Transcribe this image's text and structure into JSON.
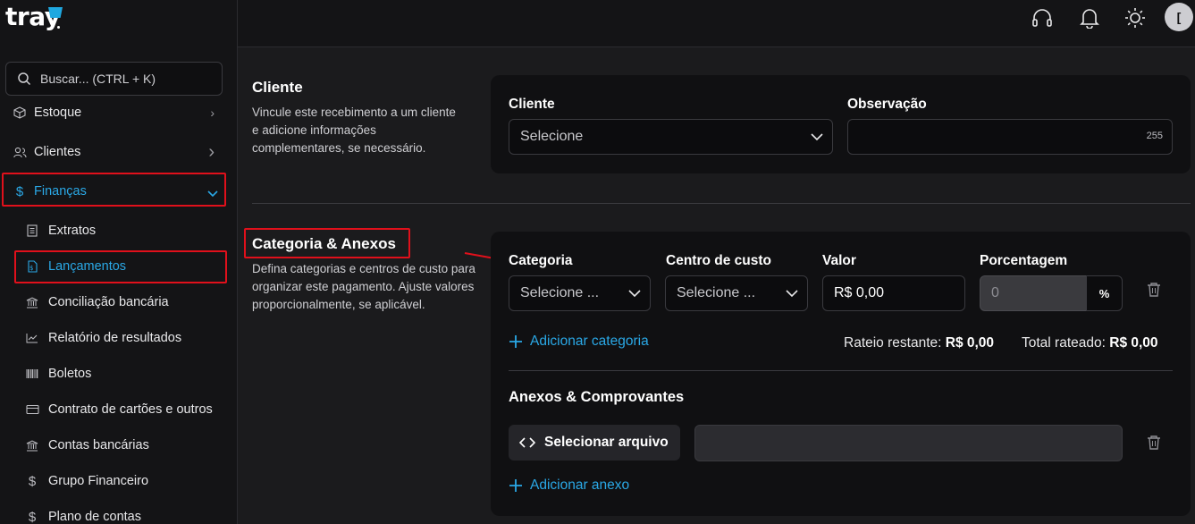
{
  "brand": {
    "logo_text": "tray"
  },
  "search": {
    "placeholder": "Buscar... (CTRL + K)"
  },
  "sidebar": {
    "items": [
      {
        "label": "Estoque",
        "icon": "box-icon"
      },
      {
        "label": "Clientes",
        "icon": "users-icon"
      },
      {
        "label": "Finanças",
        "icon": "dollar-icon"
      }
    ],
    "sub_items": [
      {
        "label": "Extratos",
        "icon": "document-icon"
      },
      {
        "label": "Lançamentos",
        "icon": "file-dollar-icon"
      },
      {
        "label": "Conciliação bancária",
        "icon": "bank-icon"
      },
      {
        "label": "Relatório de resultados",
        "icon": "chart-line-icon"
      },
      {
        "label": "Boletos",
        "icon": "barcode-icon"
      },
      {
        "label": "Contrato de cartões e outros",
        "icon": "credit-card-icon"
      },
      {
        "label": "Contas bancárias",
        "icon": "bank-icon"
      },
      {
        "label": "Grupo Financeiro",
        "icon": "dollar-icon"
      },
      {
        "label": "Plano de contas",
        "icon": "dollar-icon"
      }
    ]
  },
  "topbar": {
    "avatar_initial": "["
  },
  "cliente_section": {
    "title": "Cliente",
    "description": "Vincule este recebimento a um cliente e adicione informações complementares, se necessário.",
    "cliente_label": "Cliente",
    "cliente_value": "Selecione",
    "observacao_label": "Observação",
    "observacao_counter": "255"
  },
  "categoria_section": {
    "title": "Categoria & Anexos",
    "description": "Defina categorias e centros de custo para organizar este pagamento. Ajuste valores proporcionalmente, se aplicável.",
    "categoria_label": "Categoria",
    "categoria_value": "Selecione ...",
    "centro_label": "Centro de custo",
    "centro_value": "Selecione ...",
    "valor_label": "Valor",
    "valor_value": "R$ 0,00",
    "porcentagem_label": "Porcentagem",
    "porcentagem_value": "0",
    "percent_symbol": "%",
    "add_categoria": "Adicionar categoria",
    "rateio_label": "Rateio restante:",
    "rateio_value": "R$ 0,00",
    "total_label": "Total rateado:",
    "total_value": "R$ 0,00",
    "anexos_title": "Anexos & Comprovantes",
    "select_file": "Selecionar arquivo",
    "add_anexo": "Adicionar anexo"
  },
  "colors": {
    "accent": "#2aa8e6",
    "highlight": "#e0101b",
    "background": "#1b1b1d",
    "card": "#101012"
  }
}
